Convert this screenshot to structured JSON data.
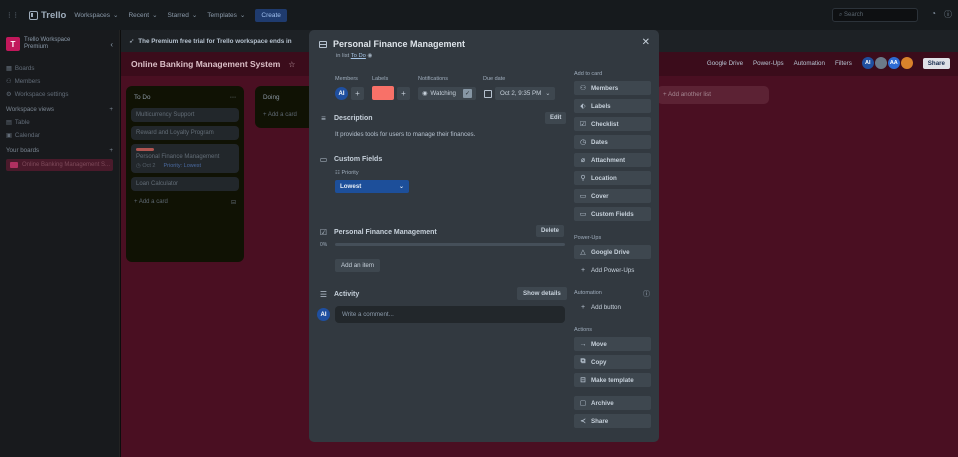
{
  "topbar": {
    "logo": "Trello",
    "menus": [
      "Workspaces",
      "Recent",
      "Starred",
      "Templates"
    ],
    "create": "Create",
    "search_placeholder": "Search"
  },
  "sidebar": {
    "workspace_name": "Trello Workspace",
    "workspace_plan": "Premium",
    "items": [
      "Boards",
      "Members",
      "Workspace settings"
    ],
    "views_header": "Workspace views",
    "views": [
      "Table",
      "Calendar"
    ],
    "boards_header": "Your boards",
    "board": "Online Banking Management S..."
  },
  "board": {
    "trial_text": "The Premium free trial for Trello workspace ends in",
    "title": "Online Banking Management System",
    "header_actions": [
      "Google Drive",
      "Power-Ups",
      "Automation",
      "Filters"
    ],
    "share": "Share",
    "add_list": "Add another list",
    "lists": [
      {
        "title": "To Do",
        "cards": [
          "Multicurrency Support",
          "Reward and Loyalty Program",
          "Personal Finance Management",
          "Loan Calculator"
        ],
        "card_meta_date": "Oct 2",
        "card_meta_priority": "Priority: Lowest",
        "add": "Add a card"
      },
      {
        "title": "Doing",
        "add": "Add a card"
      }
    ]
  },
  "modal": {
    "title": "Personal Finance Management",
    "in_list_prefix": "in list",
    "in_list": "To Do",
    "members_label": "Members",
    "member_initials": "AI",
    "labels_label": "Labels",
    "label_color": "#f87168",
    "notifications_label": "Notifications",
    "watching": "Watching",
    "due_label": "Due date",
    "due_value": "Oct 2, 9:35 PM",
    "description_title": "Description",
    "edit": "Edit",
    "description_text": "It provides tools for users to manage their finances.",
    "custom_fields_title": "Custom Fields",
    "priority_label": "Priority",
    "priority_value": "Lowest",
    "checklist_title": "Personal Finance Management",
    "delete": "Delete",
    "progress": "0%",
    "add_item": "Add an item",
    "activity_title": "Activity",
    "show_details": "Show details",
    "comment_placeholder": "Write a comment...",
    "add_to_card_label": "Add to card",
    "add_to_card": [
      "Members",
      "Labels",
      "Checklist",
      "Dates",
      "Attachment",
      "Location",
      "Cover",
      "Custom Fields"
    ],
    "powerups_label": "Power-Ups",
    "powerups": [
      "Google Drive",
      "Add Power-Ups"
    ],
    "automation_label": "Automation",
    "add_button": "Add button",
    "actions_label": "Actions",
    "actions": [
      "Move",
      "Copy",
      "Make template",
      "Archive",
      "Share"
    ]
  }
}
